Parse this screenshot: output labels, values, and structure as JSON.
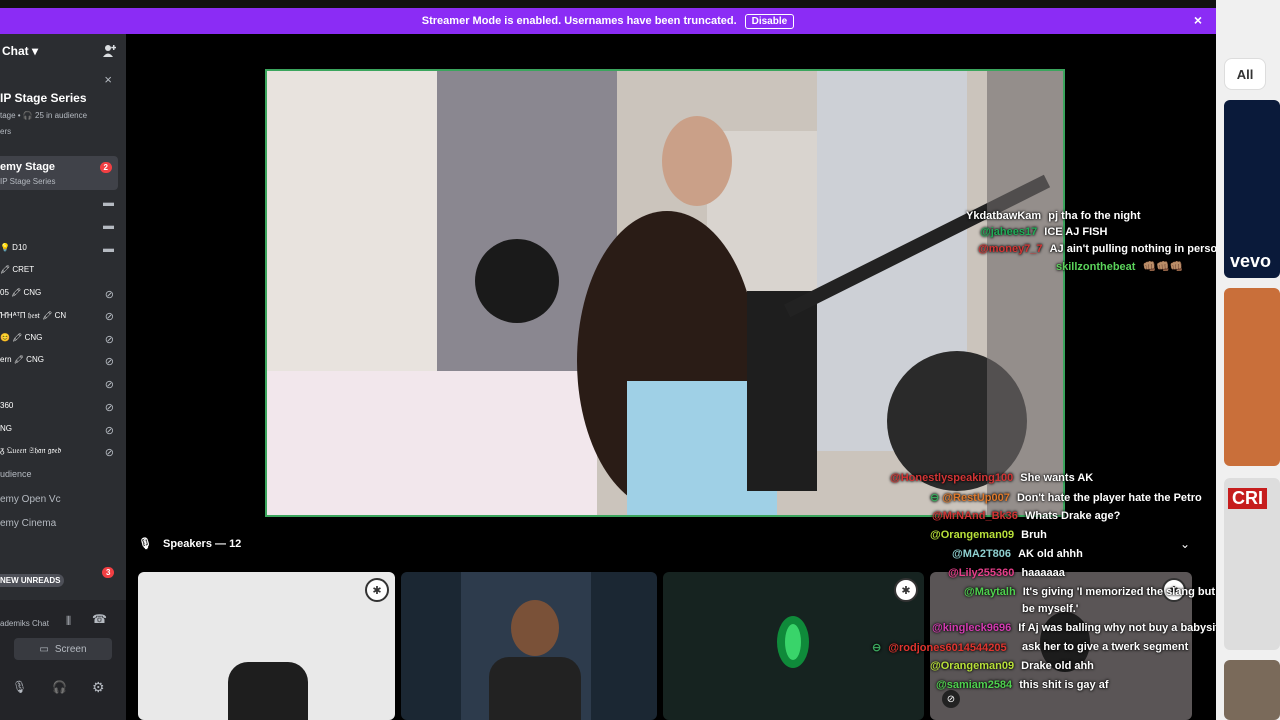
{
  "banner": {
    "message": "Streamer Mode is enabled. Usernames have been truncated.",
    "disable_label": "Disable",
    "close_icon": "×"
  },
  "sidebar": {
    "chat_header": "Chat",
    "stage_title": "IP Stage Series",
    "stage_meta": "tage • 🎧 25 in audience",
    "stage_meta2": "ers",
    "active_channel": "emy Stage",
    "active_channel_sub": "IP Stage Series",
    "active_badge": "2",
    "members": [
      {
        "label": "💡 D10"
      },
      {
        "label": "🖍 CRET"
      },
      {
        "label": "05 🖍 CNG"
      },
      {
        "label": "ꞪꞪᴬᵀΠ 𝔥𝔢𝔰𝔱 🖍 CN"
      },
      {
        "label": "😊 🖍 CNG"
      },
      {
        "label": "ern 🖍 CNG"
      },
      {
        "label": "360"
      },
      {
        "label": "NG"
      },
      {
        "label": "ᵹ 𝔔𝔲𝔢𝔢𝔫 𝔖𝔥𝔞𝔫 𝔤𝔬𝔢𝔡"
      }
    ],
    "audience_label": "udience",
    "channel_open_vc": "emy Open Vc",
    "channel_cinema": "emy Cinema",
    "new_unreads": "NEW UNREADS",
    "unreads_badge": "3",
    "bottom_channel": "ademiks Chat",
    "screen_label": "Screen"
  },
  "stream_chat_top": [
    {
      "user": "YkdatbawKam",
      "msg": "pj tha fo the night",
      "color": "#ffffff"
    },
    {
      "user": "@jahees17",
      "msg": "ICE AJ FISH",
      "color": "#1fae58"
    },
    {
      "user": "@money7_7",
      "msg": "AJ ain't pulling nothing in person.",
      "color": "#d23535"
    },
    {
      "user": "skillzonthebeat",
      "msg": "👊🏽👊🏽👊🏽",
      "color": "#5bd35b"
    }
  ],
  "stream_chat_bottom": [
    {
      "user": "@Honestlyspeaking100",
      "msg": "She wants AK",
      "color": "#d23535"
    },
    {
      "user": "@RestUp007",
      "msg": "Don't hate the player hate the Petro",
      "color": "#e07a2c"
    },
    {
      "user": "@MrNAnd_Bk36",
      "msg": "Whats Drake age?",
      "color": "#d23535"
    },
    {
      "user": "@Orangeman09",
      "msg": "Bruh",
      "color": "#b8e03a"
    },
    {
      "user": "@MA2T806",
      "msg": "AK old ahhh",
      "color": "#8fd0d0"
    },
    {
      "user": "@Lily255360",
      "msg": "haaaaaa",
      "color": "#e63e8a"
    },
    {
      "user": "@Maytalh",
      "msg": "It's giving 'I memorized the slang but forgot to",
      "color": "#4fd14f"
    },
    {
      "user": "",
      "msg": "be myself.'",
      "color": "#ffffff"
    },
    {
      "user": "@kingleck9696",
      "msg": "If Aj was balling why not buy a babysitter",
      "color": "#d23bb0"
    },
    {
      "user": "",
      "msg": "ask her to give a twerk segment",
      "color": "#ffffff"
    },
    {
      "user": "@rodjones6014544205",
      "msg": "",
      "color": "#e0352f"
    },
    {
      "user": "@Orangeman09",
      "msg": "Drake old ahh",
      "color": "#b8e03a"
    },
    {
      "user": "@samiam2584",
      "msg": "this shit is gay af",
      "color": "#4fd14f"
    }
  ],
  "speakers_label": "Speakers — 12",
  "right_panel": {
    "filter_chip": "All",
    "thumb_text_1": "vevo",
    "thumb_text_2": "CRI"
  },
  "icons": {
    "chevron": "⌄",
    "mic": "🎙",
    "headphones": "🎧",
    "gear": "⚙",
    "camera": "📹",
    "mic_off": "🎙"
  },
  "colors": {
    "banner": "#8b2cf5",
    "video_border": "#3ba55d",
    "sidebar_bg": "#2b2d31"
  }
}
